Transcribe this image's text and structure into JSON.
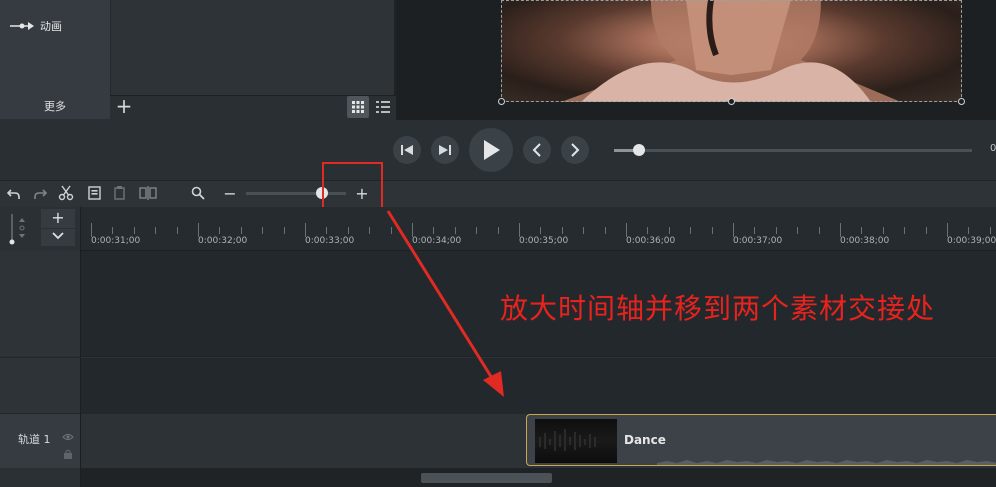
{
  "sidebar": {
    "item_label": "动画",
    "more_label": "更多",
    "add_symbol": "+"
  },
  "toolbar": {
    "zoom_out_symbol": "−",
    "zoom_in_symbol": "+",
    "zoom_level_percent": 75
  },
  "playback": {
    "scrub_value_fraction": 0.07,
    "scrub_partial_readout": "0"
  },
  "ruler": {
    "labels": [
      "0:00:31;00",
      "0:00:32;00",
      "0:00:33;00",
      "0:00:34;00",
      "0:00:35;00",
      "0:00:36;00",
      "0:00:37;00",
      "0:00:38;00",
      "0:00:39;00"
    ]
  },
  "track_side": {
    "plus_symbol": "+"
  },
  "tracks": {
    "track1_label": "轨道 1"
  },
  "clip": {
    "name": "Dance"
  },
  "annotation": {
    "text": "放大时间轴并移到两个素材交接处",
    "color": "#e8231e"
  }
}
